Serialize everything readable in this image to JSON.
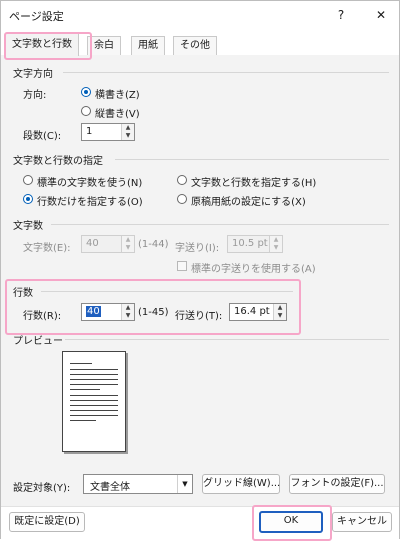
{
  "window": {
    "title": "ページ設定",
    "help_glyph": "?",
    "close_glyph": "✕"
  },
  "tabs": [
    {
      "label": "文字数と行数",
      "active": true
    },
    {
      "label": "余白"
    },
    {
      "label": "用紙"
    },
    {
      "label": "その他"
    }
  ],
  "direction": {
    "title": "文字方向",
    "label": "方向:",
    "horizontal": "横書き(Z)",
    "vertical": "縦書き(V)",
    "columns_label": "段数(C):",
    "columns_value": "1"
  },
  "grid": {
    "title": "文字数と行数の指定",
    "opt_standard": "標準の文字数を使う(N)",
    "opt_both": "文字数と行数を指定する(H)",
    "opt_lines_only": "行数だけを指定する(O)",
    "opt_manuscript": "原稿用紙の設定にする(X)"
  },
  "chars": {
    "title": "文字数",
    "count_label": "文字数(E):",
    "count_value": "40",
    "count_range": "(1-44)",
    "pitch_label": "字送り(I):",
    "pitch_value": "10.5 pt",
    "use_standard_pitch": "標準の字送りを使用する(A)"
  },
  "lines": {
    "title": "行数",
    "count_label": "行数(R):",
    "count_value": "40",
    "count_range": "(1-45)",
    "pitch_label": "行送り(T):",
    "pitch_value": "16.4 pt"
  },
  "preview": {
    "title": "プレビュー"
  },
  "apply": {
    "label": "設定対象(Y):",
    "value": "文書全体",
    "grid_button": "グリッド線(W)...",
    "font_button": "フォントの設定(F)..."
  },
  "footer": {
    "default_button": "既定に設定(D)",
    "ok_button": "OK",
    "cancel_button": "キャンセル"
  },
  "colors": {
    "accent": "#005fb8",
    "highlight": "#f6a6c8"
  }
}
